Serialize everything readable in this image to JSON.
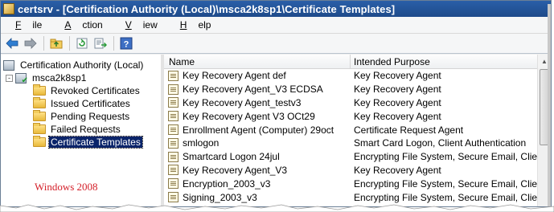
{
  "window": {
    "title": "certsrv - [Certification Authority (Local)\\msca2k8sp1\\Certificate Templates]"
  },
  "menu": [
    {
      "pre": "",
      "u": "F",
      "post": "ile"
    },
    {
      "pre": "",
      "u": "A",
      "post": "ction"
    },
    {
      "pre": "",
      "u": "V",
      "post": "iew"
    },
    {
      "pre": "",
      "u": "H",
      "post": "elp"
    }
  ],
  "toolbar": {
    "icons": [
      "back-arrow-icon",
      "forward-arrow-icon",
      "up-folder-icon",
      "refresh-icon",
      "export-list-icon",
      "help-icon"
    ]
  },
  "tree": {
    "root": "Certification Authority (Local)",
    "ca": "msca2k8sp1",
    "ca_expander": "-",
    "folders": [
      "Revoked Certificates",
      "Issued Certificates",
      "Pending Requests",
      "Failed Requests",
      "Certificate Templates"
    ],
    "selected_index": 4
  },
  "annotation": "Windows 2008",
  "list": {
    "columns": {
      "name": "Name",
      "purpose": "Intended Purpose"
    },
    "rows": [
      {
        "name": "Key Recovery Agent def",
        "purpose": "Key Recovery Agent"
      },
      {
        "name": "Key Recovery Agent_V3 ECDSA",
        "purpose": "Key Recovery Agent"
      },
      {
        "name": " Key Recovery Agent_testv3",
        "purpose": "Key Recovery Agent"
      },
      {
        "name": "Key Recovery Agent V3 OCt29",
        "purpose": "Key Recovery Agent"
      },
      {
        "name": "Enrollment Agent (Computer) 29oct",
        "purpose": "Certificate Request Agent"
      },
      {
        "name": "smlogon",
        "purpose": "Smart Card Logon, Client Authentication"
      },
      {
        "name": "Smartcard Logon 24jul",
        "purpose": "Encrypting File System, Secure Email, Clien..."
      },
      {
        "name": "Key Recovery Agent_V3",
        "purpose": "Key Recovery Agent"
      },
      {
        "name": "Encryption_2003_v3",
        "purpose": "Encrypting File System, Secure Email, Clien..."
      },
      {
        "name": "Signing_2003_v3",
        "purpose": "Encrypting File System, Secure Email, Clien..."
      }
    ]
  }
}
